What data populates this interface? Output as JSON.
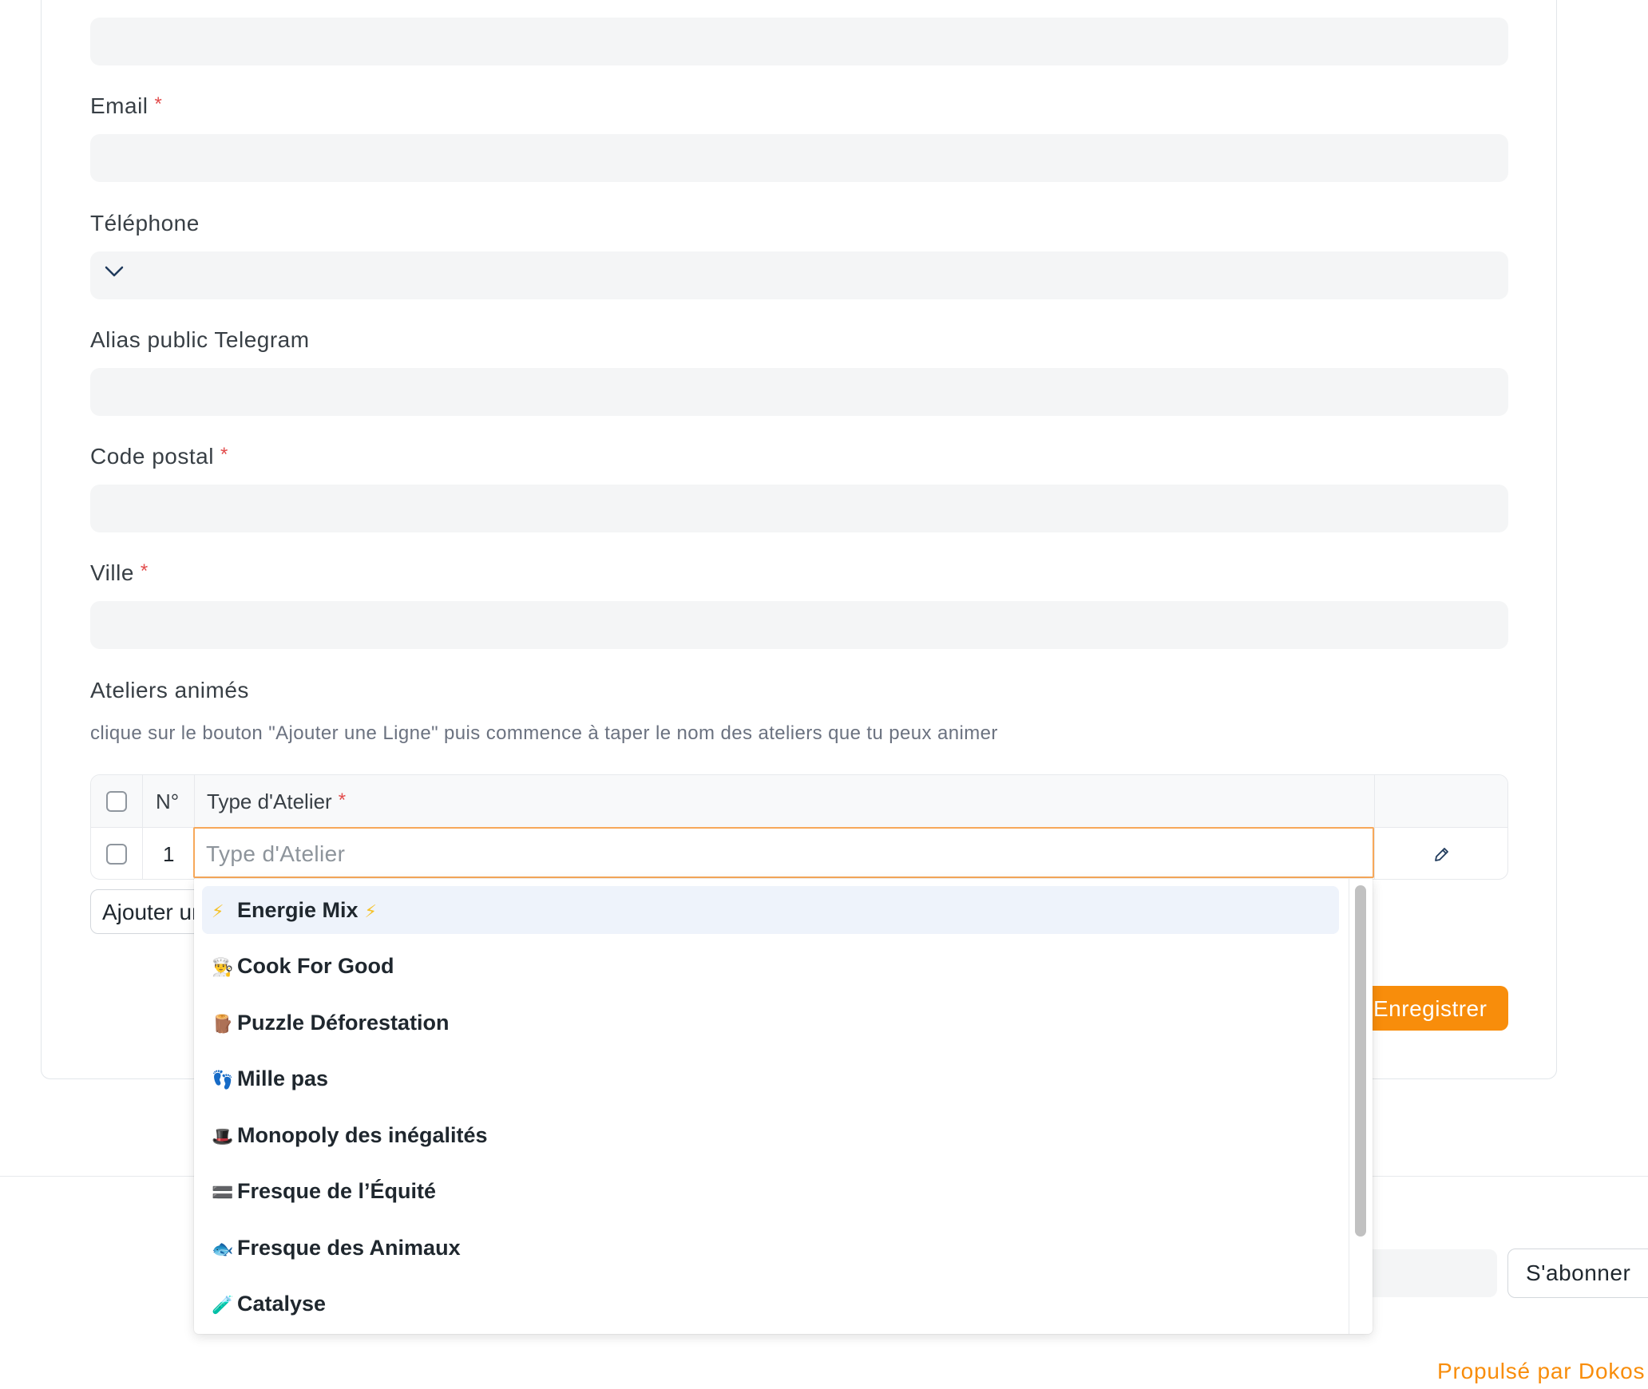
{
  "form": {
    "email_label": "Email",
    "phone_label": "Téléphone",
    "telegram_label": "Alias public Telegram",
    "postal_label": "Code postal",
    "city_label": "Ville",
    "required_mark": "*",
    "workshops_label": "Ateliers animés",
    "workshops_description": "clique sur le bouton \"Ajouter une Ligne\" puis commence à taper le nom des ateliers que tu peux animer"
  },
  "grid": {
    "col_number": "N°",
    "col_type": "Type d'Atelier",
    "rows": [
      {
        "number": "1",
        "type_placeholder": "Type d'Atelier"
      }
    ],
    "add_row_button": "Ajouter une Ligne"
  },
  "dropdown": {
    "options": [
      {
        "icon": "⚡",
        "label": "Energie Mix",
        "suffix": "⚡",
        "active": true
      },
      {
        "icon": "👨‍🍳",
        "label": "Cook For Good"
      },
      {
        "icon": "🪵",
        "label": "Puzzle Déforestation"
      },
      {
        "icon": "👣",
        "label": "Mille pas"
      },
      {
        "icon": "🎩",
        "label": "Monopoly des inégalités"
      },
      {
        "icon": "🟰",
        "label": "Fresque de l’Équité"
      },
      {
        "icon": "🐟",
        "label": "Fresque des Animaux"
      },
      {
        "icon": "🧪",
        "label": "Catalyse"
      }
    ]
  },
  "save_button": "Enregistrer",
  "footer": {
    "subscribe_button": "S'abonner",
    "powered_by": "Propulsé par Dokos"
  },
  "colors": {
    "accent": "#f88d0b",
    "required": "#e24c4c",
    "input_bg": "#f4f5f6",
    "focus_border": "#f7a85a"
  }
}
